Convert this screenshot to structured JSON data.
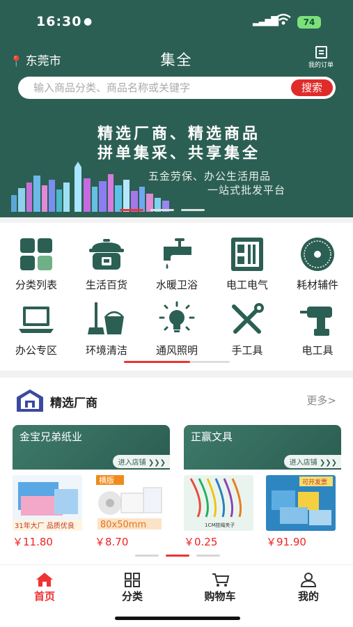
{
  "status_bar": {
    "time": "16:30",
    "battery": "74"
  },
  "header": {
    "city": "东莞市",
    "title": "集全",
    "orders_label": "我的订单",
    "search_placeholder": "输入商品分类、商品名称或关键字",
    "search_button": "搜索"
  },
  "banner": {
    "line1": "精选厂商、精选商品",
    "line2": "拼单集采、共享集全",
    "sub1": "五金劳保、办公生活用品",
    "sub2": "一站式批发平台"
  },
  "categories": [
    {
      "label": "分类列表",
      "icon": "grid-icon"
    },
    {
      "label": "生活百货",
      "icon": "rice-cooker-icon"
    },
    {
      "label": "水暖卫浴",
      "icon": "faucet-icon"
    },
    {
      "label": "电工电气",
      "icon": "electric-box-icon"
    },
    {
      "label": "耗材辅件",
      "icon": "saw-blade-icon"
    },
    {
      "label": "办公专区",
      "icon": "laptop-icon"
    },
    {
      "label": "环境清洁",
      "icon": "mop-bucket-icon"
    },
    {
      "label": "通风照明",
      "icon": "lightbulb-icon"
    },
    {
      "label": "手工具",
      "icon": "wrench-screwdriver-icon"
    },
    {
      "label": "电工具",
      "icon": "drill-icon"
    }
  ],
  "featured": {
    "title": "精选厂商",
    "more": "更多>",
    "stores": [
      {
        "name": "金宝兄弟纸业",
        "enter": "进入店铺 ❯❯❯",
        "products": [
          {
            "price": "￥11.80",
            "badge": "31年大厂品质优良"
          },
          {
            "price": "￥8.70",
            "badge": "横版 80x50mm"
          }
        ]
      },
      {
        "name": "正赢文具",
        "enter": "进入店铺 ❯❯❯",
        "products": [
          {
            "price": "￥0.25",
            "badge": "1CM挂绳夹子"
          },
          {
            "price": "￥91.90",
            "badge": "可开发票"
          }
        ]
      }
    ]
  },
  "tabbar": [
    {
      "label": "首页",
      "icon": "home-icon",
      "active": true
    },
    {
      "label": "分类",
      "icon": "grid-icon",
      "active": false
    },
    {
      "label": "购物车",
      "icon": "cart-icon",
      "active": false
    },
    {
      "label": "我的",
      "icon": "user-icon",
      "active": false
    }
  ],
  "colors": {
    "primary": "#2c5f53",
    "accent": "#e33333",
    "price": "#e22222"
  }
}
